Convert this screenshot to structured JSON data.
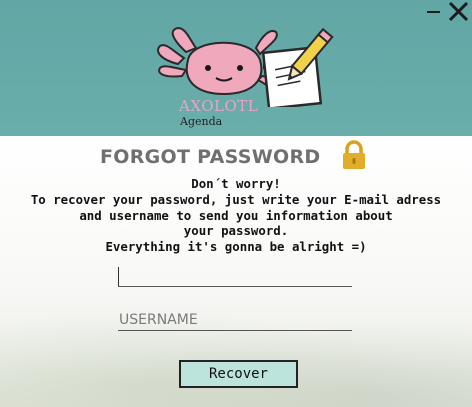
{
  "window": {
    "minimize_icon": "minimize-icon",
    "close_icon": "close-icon"
  },
  "header": {
    "brand": "AXOLOTL",
    "brand_sub": "Agenda",
    "colors": {
      "teal": "#62a7a5",
      "pink": "#f0a8bc",
      "brand_pink": "#e8a4c4"
    }
  },
  "main": {
    "title": "FORGOT PASSWORD",
    "title_icon": "lock-icon",
    "message": [
      "Don´t worry!",
      "To recover your password, just write your E-mail adress",
      "and username to send you information about",
      "your password.",
      "Everything it's gonna be alright =)"
    ]
  },
  "form": {
    "email": {
      "value": "",
      "placeholder": ""
    },
    "username": {
      "value": "",
      "placeholder": "USERNAME"
    },
    "recover_label": "Recover",
    "button_color": "#bde3dd"
  }
}
